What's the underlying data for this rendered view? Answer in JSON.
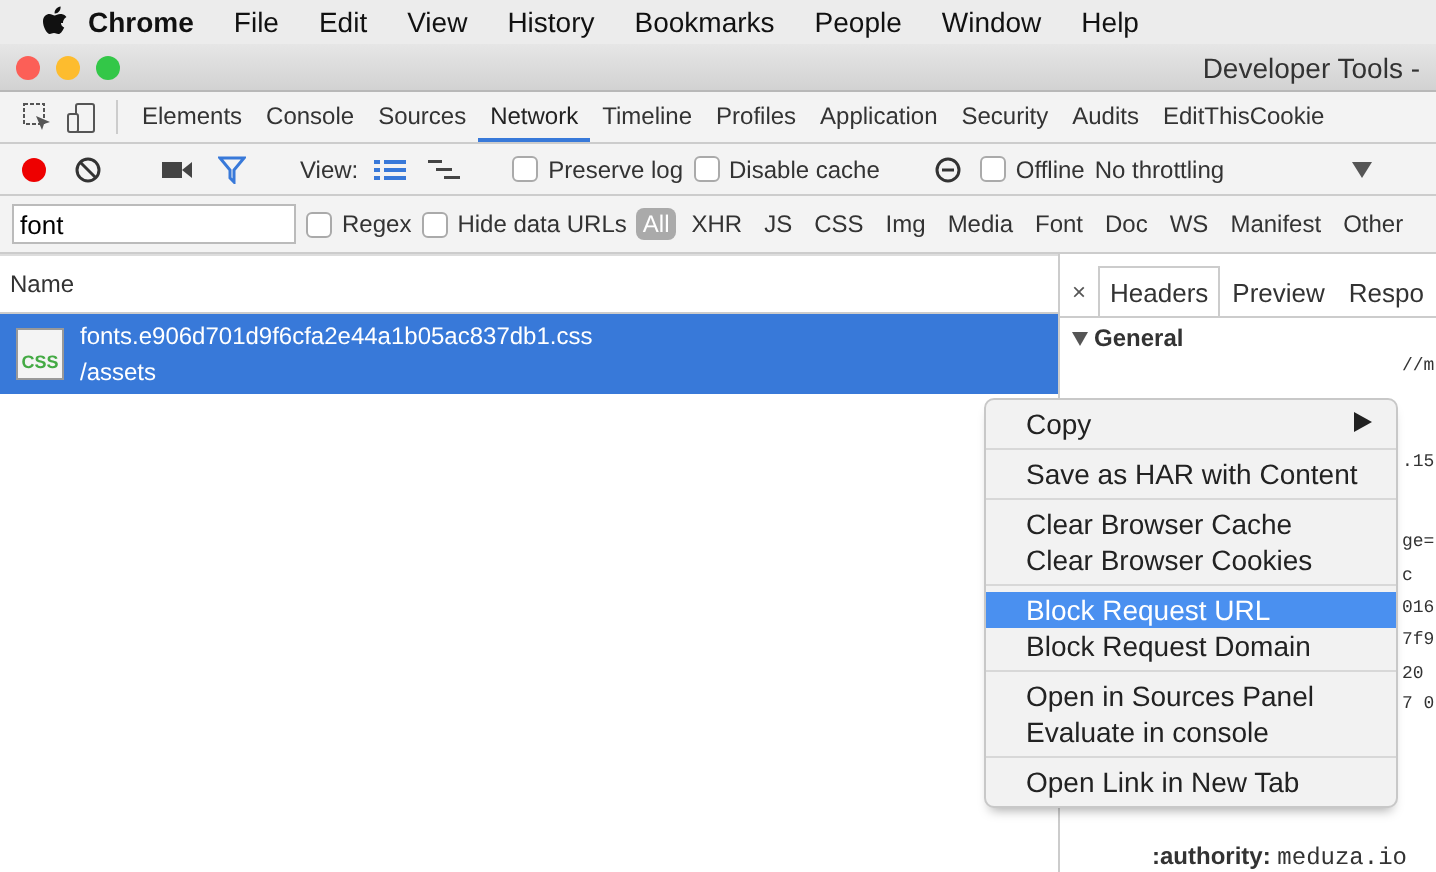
{
  "menubar": {
    "app": "Chrome",
    "items": [
      "File",
      "Edit",
      "View",
      "History",
      "Bookmarks",
      "People",
      "Window",
      "Help"
    ]
  },
  "window": {
    "title": "Developer Tools -"
  },
  "panel_tabs": [
    {
      "label": "Elements",
      "selected": false
    },
    {
      "label": "Console",
      "selected": false
    },
    {
      "label": "Sources",
      "selected": false
    },
    {
      "label": "Network",
      "selected": true
    },
    {
      "label": "Timeline",
      "selected": false
    },
    {
      "label": "Profiles",
      "selected": false
    },
    {
      "label": "Application",
      "selected": false
    },
    {
      "label": "Security",
      "selected": false
    },
    {
      "label": "Audits",
      "selected": false
    },
    {
      "label": "EditThisCookie",
      "selected": false
    }
  ],
  "toolbar": {
    "recording": true,
    "view_label": "View:",
    "preserve_log": {
      "label": "Preserve log",
      "checked": false
    },
    "disable_cache": {
      "label": "Disable cache",
      "checked": false
    },
    "offline": {
      "label": "Offline",
      "checked": false
    },
    "throttling": "No throttling"
  },
  "filter": {
    "value": "font",
    "regex": {
      "label": "Regex",
      "checked": false
    },
    "hide_data_urls": {
      "label": "Hide data URLs",
      "checked": false
    },
    "types": [
      {
        "label": "All",
        "selected": true
      },
      {
        "label": "XHR",
        "selected": false
      },
      {
        "label": "JS",
        "selected": false
      },
      {
        "label": "CSS",
        "selected": false
      },
      {
        "label": "Img",
        "selected": false
      },
      {
        "label": "Media",
        "selected": false
      },
      {
        "label": "Font",
        "selected": false
      },
      {
        "label": "Doc",
        "selected": false
      },
      {
        "label": "WS",
        "selected": false
      },
      {
        "label": "Manifest",
        "selected": false
      },
      {
        "label": "Other",
        "selected": false
      }
    ]
  },
  "requests": {
    "column": "Name",
    "rows": [
      {
        "name": "fonts.e906d701d9f6cfa2e44a1b05ac837db1.css",
        "path": "/assets",
        "file_type": "CSS",
        "selected": true
      }
    ]
  },
  "details": {
    "close": "×",
    "tabs": [
      {
        "label": "Headers",
        "selected": true
      },
      {
        "label": "Preview",
        "selected": false
      },
      {
        "label": "Respo",
        "selected": false
      }
    ],
    "section": "General",
    "fragments": [
      "//m",
      ".15",
      "ge=",
      "c",
      "016",
      "7f9",
      "20",
      "7 0"
    ],
    "authority": {
      "key": ":authority:",
      "value": "meduza.io"
    }
  },
  "context_menu": [
    [
      {
        "label": "Copy",
        "submenu": true,
        "selected": false
      }
    ],
    [
      {
        "label": "Save as HAR with Content",
        "submenu": false,
        "selected": false
      }
    ],
    [
      {
        "label": "Clear Browser Cache",
        "submenu": false,
        "selected": false
      },
      {
        "label": "Clear Browser Cookies",
        "submenu": false,
        "selected": false
      }
    ],
    [
      {
        "label": "Block Request URL",
        "submenu": false,
        "selected": true
      },
      {
        "label": "Block Request Domain",
        "submenu": false,
        "selected": false
      }
    ],
    [
      {
        "label": "Open in Sources Panel",
        "submenu": false,
        "selected": false
      },
      {
        "label": "Evaluate in console",
        "submenu": false,
        "selected": false
      }
    ],
    [
      {
        "label": "Open Link in New Tab",
        "submenu": false,
        "selected": false
      }
    ]
  ]
}
